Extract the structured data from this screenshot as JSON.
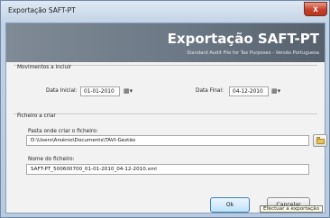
{
  "window": {
    "title": "Exportação SAFT-PT",
    "close_glyph": "x"
  },
  "banner": {
    "title": "Exportação SAFT-PT",
    "subtitle": "Standard Audit File for Tax Purposes - Versão Portuguesa"
  },
  "movements": {
    "group_label": "Movimentos a incluir",
    "start_label": "Data Inicial:",
    "start_value": "01-01-2010",
    "end_label": "Data Final:",
    "end_value": "04-12-2010",
    "calendar_glyph": "▦▾"
  },
  "file": {
    "group_label": "Ficheiro a criar",
    "folder_label": "Pasta onde criar o ficheiro:",
    "folder_value": "D:\\Users\\Arsénio\\Documents\\TAVI-Gestão",
    "name_label": "Nome do ficheiro:",
    "name_value": "SAFT-PT_500600700_01-01-2010_04-12-2010.xml"
  },
  "buttons": {
    "ok_label": "Ok",
    "cancel_label": "Cancelar"
  },
  "tooltip": {
    "text": "Efectuar a exportação"
  },
  "colors": {
    "banner": "#6c7885",
    "close": "#c5402b",
    "default_button_border": "#3c7fb1"
  }
}
